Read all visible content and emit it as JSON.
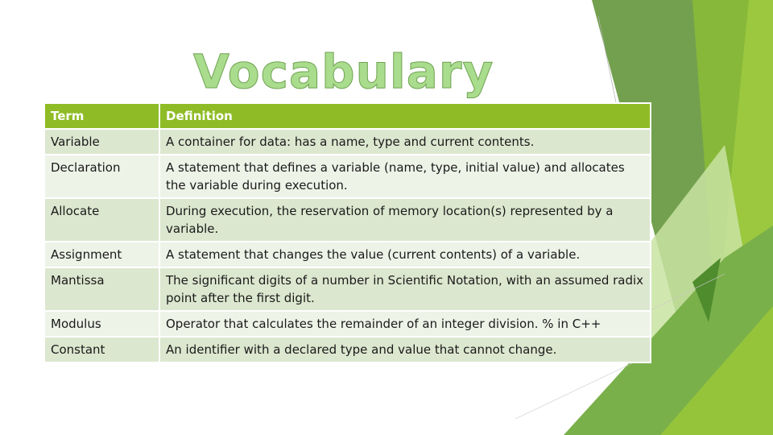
{
  "slide": {
    "title": "Vocabulary",
    "colors": {
      "accent": "#8fbc26",
      "title_fill": "#a9dc8c",
      "row_dark": "#dce7cf",
      "row_light": "#eef3e8"
    }
  },
  "table": {
    "headers": {
      "term": "Term",
      "definition": "Definition"
    },
    "rows": [
      {
        "term": "Variable",
        "definition": "A container for data: has a name, type and current contents."
      },
      {
        "term": "Declaration",
        "definition": "A statement that defines a variable (name, type, initial value) and allocates the variable during execution."
      },
      {
        "term": "Allocate",
        "definition": "During execution, the reservation of memory location(s) represented by a variable."
      },
      {
        "term": "Assignment",
        "definition": "A statement that changes the value (current contents) of a variable."
      },
      {
        "term": "Mantissa",
        "definition": "The significant digits of a number in Scientific Notation, with an assumed radix point after the first digit."
      },
      {
        "term": "Modulus",
        "definition": "Operator that calculates the remainder of an integer division. % in C++"
      },
      {
        "term": "Constant",
        "definition": "An identifier with a declared type and value that cannot change."
      }
    ]
  }
}
